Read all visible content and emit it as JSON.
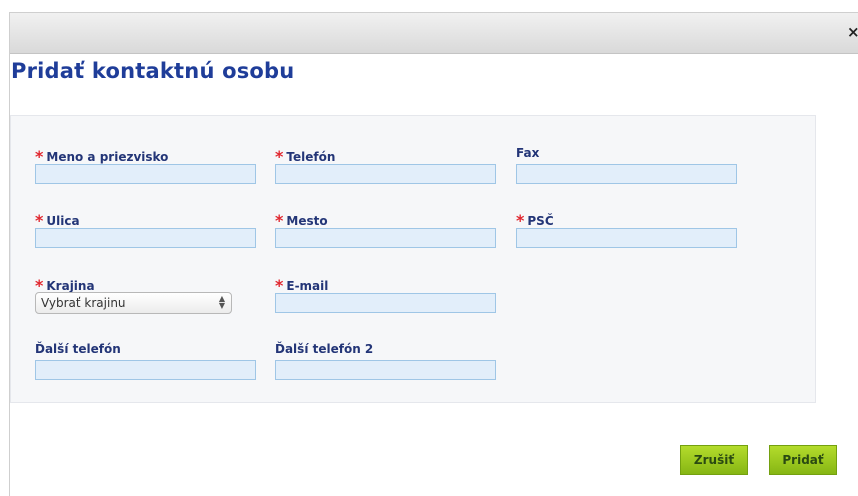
{
  "dialog": {
    "close_icon": "×",
    "title": "Pridať kontaktnú osobu"
  },
  "form": {
    "required_mark": "*",
    "fields": {
      "name": {
        "label": "Meno a priezvisko",
        "value": ""
      },
      "phone": {
        "label": "Telefón",
        "value": ""
      },
      "fax": {
        "label": "Fax",
        "value": ""
      },
      "street": {
        "label": "Ulica",
        "value": ""
      },
      "city": {
        "label": "Mesto",
        "value": ""
      },
      "zip": {
        "label": "PSČ",
        "value": ""
      },
      "country": {
        "label": "Krajina",
        "selected": "Vybrať krajinu"
      },
      "email": {
        "label": "E-mail",
        "value": ""
      },
      "phone_other": {
        "label": "Ďalší telefón",
        "value": ""
      },
      "phone_other2": {
        "label": "Ďalší telefón 2",
        "value": ""
      }
    }
  },
  "buttons": {
    "cancel": "Zrušiť",
    "add": "Pridať"
  },
  "colors": {
    "heading": "#1f3d99",
    "label": "#233577",
    "required": "#e0262e",
    "input_bg": "#e2eefa",
    "button": "#9ccb1f"
  }
}
